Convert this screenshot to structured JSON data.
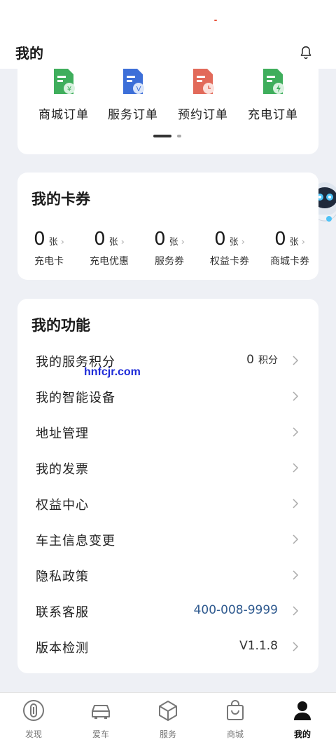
{
  "header": {
    "title": "我的"
  },
  "orders": [
    {
      "label": "商城订单",
      "icon": "mall-order-icon",
      "color": "#3fae5c"
    },
    {
      "label": "服务订单",
      "icon": "service-order-icon",
      "color": "#3d6fd8"
    },
    {
      "label": "预约订单",
      "icon": "appointment-order-icon",
      "color": "#e26a5a"
    },
    {
      "label": "充电订单",
      "icon": "charging-order-icon",
      "color": "#3fae5c"
    }
  ],
  "coupons": {
    "title": "我的卡券",
    "items": [
      {
        "count": "0",
        "unit": "张",
        "label": "充电卡"
      },
      {
        "count": "0",
        "unit": "张",
        "label": "充电优惠"
      },
      {
        "count": "0",
        "unit": "张",
        "label": "服务券"
      },
      {
        "count": "0",
        "unit": "张",
        "label": "权益卡券"
      },
      {
        "count": "0",
        "unit": "张",
        "label": "商城卡券"
      }
    ]
  },
  "functions": {
    "title": "我的功能",
    "items": [
      {
        "label": "我的服务积分",
        "value": "0",
        "value_unit": "积分"
      },
      {
        "label": "我的智能设备",
        "value": ""
      },
      {
        "label": "地址管理",
        "value": ""
      },
      {
        "label": "我的发票",
        "value": ""
      },
      {
        "label": "权益中心",
        "value": ""
      },
      {
        "label": "车主信息变更",
        "value": ""
      },
      {
        "label": "隐私政策",
        "value": ""
      },
      {
        "label": "联系客服",
        "value": "400-008-9999"
      },
      {
        "label": "版本检测",
        "value": "V1.1.8"
      }
    ]
  },
  "watermark": "hnfcjr.com",
  "tabs": [
    {
      "label": "发现",
      "icon": "discover-icon",
      "active": false
    },
    {
      "label": "爱车",
      "icon": "car-icon",
      "active": false
    },
    {
      "label": "服务",
      "icon": "service-cube-icon",
      "active": false
    },
    {
      "label": "商城",
      "icon": "shopping-bag-icon",
      "active": false
    },
    {
      "label": "我的",
      "icon": "person-icon",
      "active": true
    }
  ]
}
